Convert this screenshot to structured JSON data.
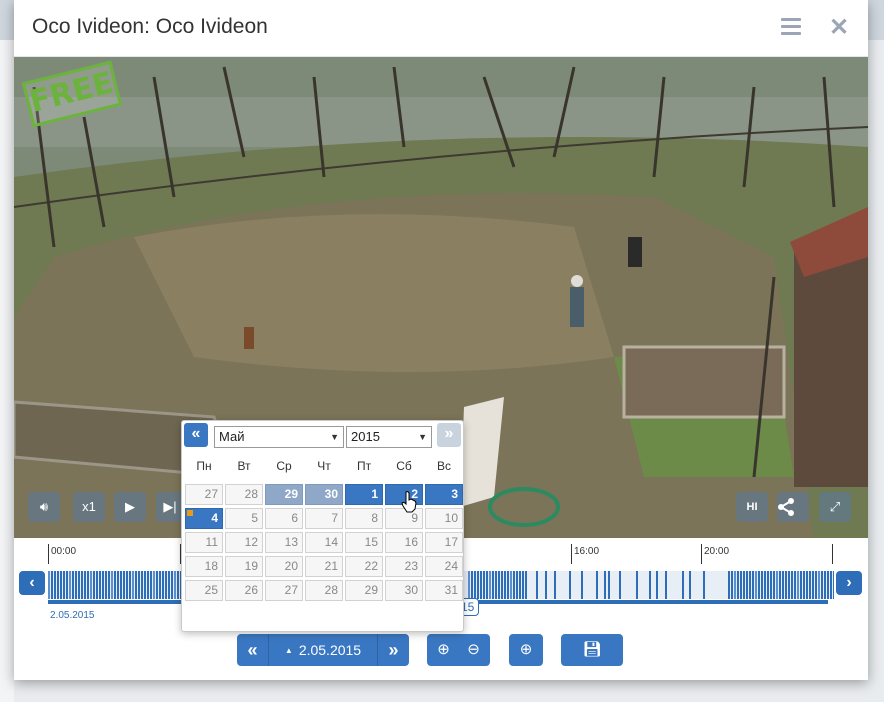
{
  "window": {
    "title": "Oco Ivideon: Oco Ivideon"
  },
  "video": {
    "watermark": "FREE",
    "controls": {
      "speed_label": "x1",
      "quality_label": "HI"
    }
  },
  "timeline": {
    "ticks": [
      "00:00",
      "16:00",
      "20:00"
    ],
    "start_date": "2.05.2015",
    "position_fragment": "15"
  },
  "calendar": {
    "month": "Май",
    "year": "2015",
    "weekdays": [
      "Пн",
      "Вт",
      "Ср",
      "Чт",
      "Пт",
      "Сб",
      "Вс"
    ],
    "weeks": [
      [
        "27",
        "28",
        "29",
        "30",
        "1",
        "2",
        "3"
      ],
      [
        "4",
        "5",
        "6",
        "7",
        "8",
        "9",
        "10"
      ],
      [
        "11",
        "12",
        "13",
        "14",
        "15",
        "16",
        "17"
      ],
      [
        "18",
        "19",
        "20",
        "21",
        "22",
        "23",
        "24"
      ],
      [
        "25",
        "26",
        "27",
        "28",
        "29",
        "30",
        "31"
      ]
    ],
    "selected_day": "2",
    "today_day": "4"
  },
  "bottom_bar": {
    "current_date": "2.05.2015"
  },
  "colors": {
    "accent": "#3a77c3",
    "timeline_fill": "#2e6db7",
    "today_marker": "#e89a1c"
  }
}
